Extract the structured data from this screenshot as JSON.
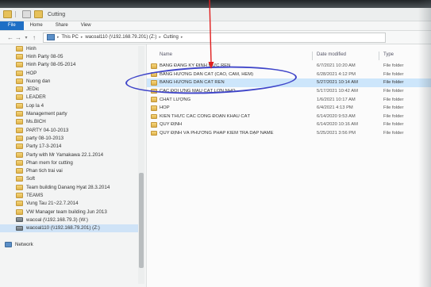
{
  "window": {
    "title": "Cutting"
  },
  "ribbon": {
    "tabs": [
      "File",
      "Home",
      "Share",
      "View"
    ]
  },
  "address": {
    "crumbs": [
      "This PC",
      "wacoal110 (\\\\192.168.79.201) (Z:)",
      "Cutting"
    ]
  },
  "nav_pane": {
    "items": [
      {
        "label": "Hinh",
        "kind": "folder"
      },
      {
        "label": "Hinh Party 08-05",
        "kind": "folder"
      },
      {
        "label": "Hinh Party 08-05-2014",
        "kind": "folder"
      },
      {
        "label": "HOP",
        "kind": "folder"
      },
      {
        "label": "Nuong dan",
        "kind": "folder"
      },
      {
        "label": "JEDic",
        "kind": "folder"
      },
      {
        "label": "LEADER",
        "kind": "folder"
      },
      {
        "label": "Lop la 4",
        "kind": "folder"
      },
      {
        "label": "Management party",
        "kind": "folder"
      },
      {
        "label": "Ms.BICH",
        "kind": "folder"
      },
      {
        "label": "PARTY 04-10-2013",
        "kind": "folder"
      },
      {
        "label": "party 08-10-2013",
        "kind": "folder"
      },
      {
        "label": "Party 17-3-2014",
        "kind": "folder"
      },
      {
        "label": "Party with Mr Yamakawa 22.1.2014",
        "kind": "folder"
      },
      {
        "label": "Phan mem for cutting",
        "kind": "folder"
      },
      {
        "label": "Phan tich trai vai",
        "kind": "folder"
      },
      {
        "label": "Soft",
        "kind": "folder"
      },
      {
        "label": "Team building Danang Hyat 28.3.2014",
        "kind": "folder"
      },
      {
        "label": "TEAMS",
        "kind": "folder"
      },
      {
        "label": "Vung Tau 21~22.7.2014",
        "kind": "folder"
      },
      {
        "label": "VW Manager team building Jun 2013",
        "kind": "folder"
      },
      {
        "label": "wacoal (\\\\192.168.79.3) (W:)",
        "kind": "drive"
      },
      {
        "label": "wacoal110 (\\\\192.168.79.201) (Z:)",
        "kind": "drive",
        "selected": true
      },
      {
        "label": "",
        "kind": "spacer"
      },
      {
        "label": "Network",
        "kind": "network"
      }
    ]
  },
  "file_list": {
    "columns": {
      "name": "Name",
      "date": "Date modified",
      "type": "Type"
    },
    "rows": [
      {
        "name": "BẢNG ĐĂNG KÝ ĐỊNH MỨC REN",
        "date": "6/7/2021 10:20 AM",
        "type": "File folder",
        "selected": false
      },
      {
        "name": "BẢNG HƯỚNG DẪN CẮT (CAO, CAM, HEM)",
        "date": "6/28/2021 4:12 PM",
        "type": "File folder",
        "selected": false
      },
      {
        "name": "BẢNG HƯỚNG DẪN CẮT REN",
        "date": "5/27/2021 10:14 AM",
        "type": "File folder",
        "selected": true
      },
      {
        "name": "CÁC ĐỐI ỨNG MẪU CẮT LỚN NHỎ",
        "date": "5/17/2021 10:42 AM",
        "type": "File folder",
        "selected": false
      },
      {
        "name": "CHẤT LƯỢNG",
        "date": "1/6/2021 10:17 AM",
        "type": "File folder",
        "selected": false
      },
      {
        "name": "HOP",
        "date": "6/4/2021 4:13 PM",
        "type": "File folder",
        "selected": false
      },
      {
        "name": "KIẾN THỨC CÁC CÔNG ĐOẠN KHÂU CẮT",
        "date": "6/14/2020 9:53 AM",
        "type": "File folder",
        "selected": false
      },
      {
        "name": "QUY ĐỊNH",
        "date": "6/14/2020 10:16 AM",
        "type": "File folder",
        "selected": false
      },
      {
        "name": "QUY ĐỊNH VÀ PHƯƠNG PHÁP KIỂM TRA DẬP NAME",
        "date": "5/25/2021 3:56 PM",
        "type": "File folder",
        "selected": false
      }
    ]
  },
  "annotation": {
    "arrow_color": "#e01e1e",
    "ellipse_color": "#3f45c9"
  }
}
